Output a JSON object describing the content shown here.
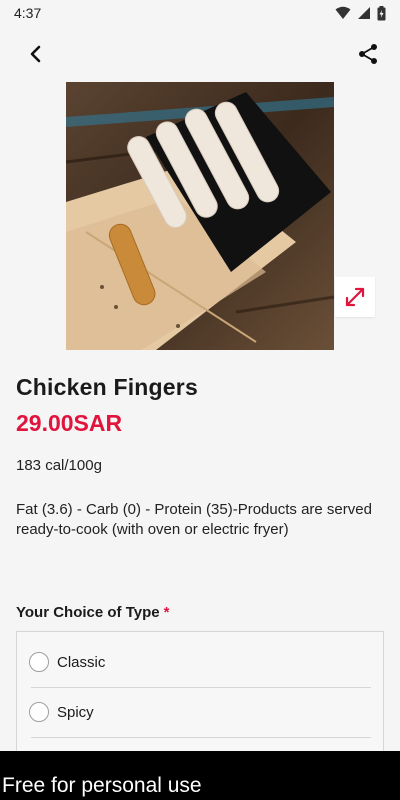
{
  "status_bar": {
    "time": "4:37",
    "icons": [
      "wifi-icon",
      "signal-icon",
      "battery-icon"
    ]
  },
  "app_bar": {
    "back_icon": "arrow-back-icon",
    "share_icon": "share-icon"
  },
  "product": {
    "image": "chicken-fingers-photo",
    "name": "Chicken Fingers",
    "price": "29.00SAR",
    "calories": "183 cal/100g",
    "description": "Fat (3.6) - Carb (0) - Protein (35)-Products are served ready-to-cook (with oven or electric fryer)"
  },
  "choices": {
    "title": "Your Choice of Type",
    "required_marker": "*",
    "options": [
      {
        "label": "Classic"
      },
      {
        "label": "Spicy"
      }
    ]
  },
  "watermark": {
    "text": "Free for personal use"
  },
  "colors": {
    "accent": "#e0143c",
    "background": "#f5f5f5"
  }
}
